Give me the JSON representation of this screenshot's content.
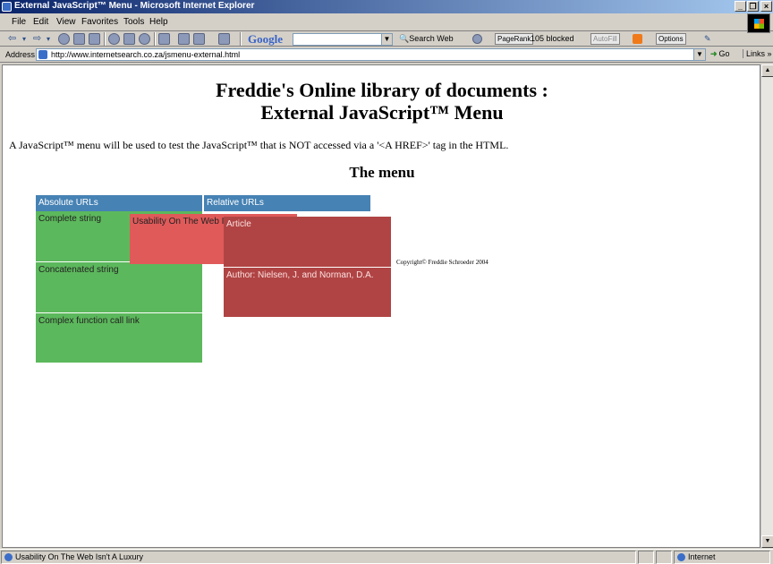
{
  "window": {
    "title": "External JavaScript™ Menu - Microsoft Internet Explorer",
    "minimize": "_",
    "restore": "❐",
    "close": "×"
  },
  "menubar": {
    "items": [
      "File",
      "Edit",
      "View",
      "Favorites",
      "Tools",
      "Help"
    ]
  },
  "toolbar": {
    "google_logo": "Google",
    "google_search_value": "",
    "search_web": "Search Web",
    "pagerank": "PageRank",
    "blocked": "105 blocked",
    "autofill": "AutoFill",
    "options": "Options"
  },
  "address": {
    "label": "Address",
    "url": "http://www.internetsearch.co.za/jsmenu-external.html",
    "go": "Go",
    "links": "Links »"
  },
  "page": {
    "heading_line1": "Freddie's Online library of documents :",
    "heading_line2": "External JavaScript™ Menu",
    "intro": "A JavaScript™ menu will be used to test the JavaScript™ that is NOT accessed via a '<A HREF>' tag in the HTML.",
    "menu_heading": "The menu",
    "copyright": "Copyright©  Freddie Schroeder 2004"
  },
  "demo_menu": {
    "headers": [
      "Absolute URLs",
      "Relative URLs"
    ],
    "left_items": [
      "Complete string",
      "Concatenated string",
      "Complex function call link"
    ],
    "popup_item": "Usability On The Web Isn't A Luxury",
    "submenu_items": [
      "Article",
      "Author: Nielsen, J. and Norman, D.A."
    ]
  },
  "statusbar": {
    "message": "Usability On The Web Isn't A Luxury",
    "zone": "Internet"
  },
  "colors": {
    "menu_header": "#4682b4",
    "menu_green": "#5cb85c",
    "popup_red": "#e05a5a",
    "submenu_red": "#b04444"
  }
}
